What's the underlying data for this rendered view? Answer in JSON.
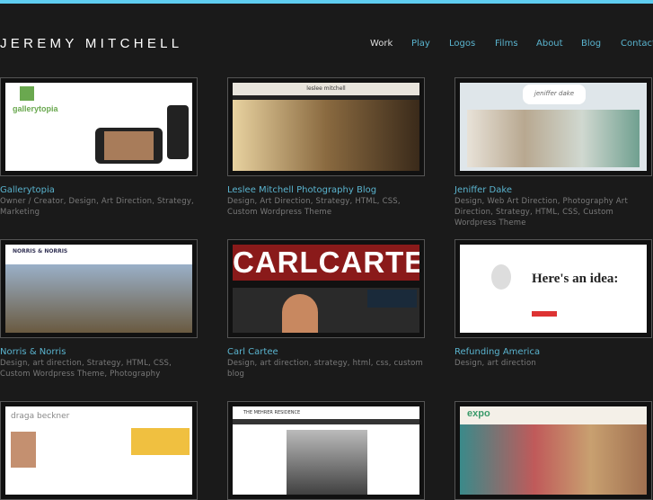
{
  "site": {
    "logo": "JEREMY MITCHELL",
    "accent": "#5fcdf0"
  },
  "nav": [
    {
      "label": "Work",
      "active": true
    },
    {
      "label": "Play"
    },
    {
      "label": "Logos"
    },
    {
      "label": "Films"
    },
    {
      "label": "About"
    },
    {
      "label": "Blog"
    },
    {
      "label": "Contact"
    }
  ],
  "projects": [
    {
      "title": "Gallerytopia",
      "desc": "Owner / Creator, Design, Art Direction, Strategy, Marketing",
      "thumb": "gallerytopia"
    },
    {
      "title": "Leslee Mitchell Photography Blog",
      "desc": "Design, Art Direction, Strategy, HTML, CSS, Custom Wordpress Theme",
      "thumb": "leslee mitchell"
    },
    {
      "title": "Jeniffer Dake",
      "desc": "Design, Web Art Direction, Photography Art Direction, Strategy, HTML, CSS, Custom Wordpress Theme",
      "thumb": "jeniffer dake"
    },
    {
      "title": "Norris & Norris",
      "desc": "Design, art direction, Strategy, HTML, CSS, Custom Wordpress Theme, Photography",
      "thumb": "NORRIS & NORRIS"
    },
    {
      "title": "Carl Cartee",
      "desc": "Design, art direction, strategy, html, css, custom blog",
      "thumb": "CARLCARTEE"
    },
    {
      "title": "Refunding America",
      "desc": "Design, art direction",
      "thumb": "Here's an idea:"
    },
    {
      "title": "",
      "desc": "",
      "thumb": "draga beckner"
    },
    {
      "title": "",
      "desc": "",
      "thumb": "THE MEHRER RESIDENCE"
    },
    {
      "title": "",
      "desc": "",
      "thumb": "expo"
    }
  ]
}
